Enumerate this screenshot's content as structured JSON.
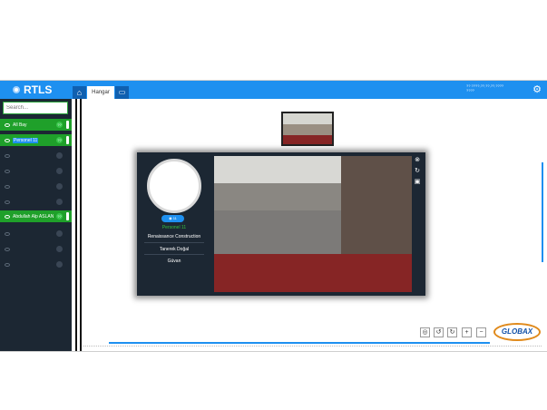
{
  "app": {
    "title": "RTLS"
  },
  "header": {
    "tabs": [
      {
        "label": "Hangar"
      }
    ],
    "coords_line1": "?? ????,??,??,??,????",
    "coords_line2": "????"
  },
  "sidebar": {
    "search_placeholder": "Search...",
    "items": [
      {
        "label": "All Bay",
        "count": "??",
        "active": true
      },
      {
        "label": "Personel 11",
        "count": "??",
        "active": true
      },
      {
        "label": "",
        "count": "",
        "active": false
      },
      {
        "label": "",
        "count": "",
        "active": false
      },
      {
        "label": "",
        "count": "",
        "active": false
      },
      {
        "label": "",
        "count": "",
        "active": false
      },
      {
        "label": "Abdullah Alp ASLAN",
        "count": "??",
        "active": true
      },
      {
        "label": "",
        "count": "",
        "active": false
      },
      {
        "label": "",
        "count": "",
        "active": false
      },
      {
        "label": "",
        "count": "",
        "active": false
      }
    ]
  },
  "popup": {
    "badge": "11",
    "person_name": "Personel 11",
    "company": "Renaissance Construction",
    "person_detail": "Tanerek Doğal",
    "role": "Güvan"
  },
  "footer": {
    "logo": "GLOBAX"
  },
  "colors": {
    "accent": "#1e90f0",
    "active_item": "#1fa02a",
    "sidebar_bg": "#1c2733",
    "video_red": "#862525"
  }
}
